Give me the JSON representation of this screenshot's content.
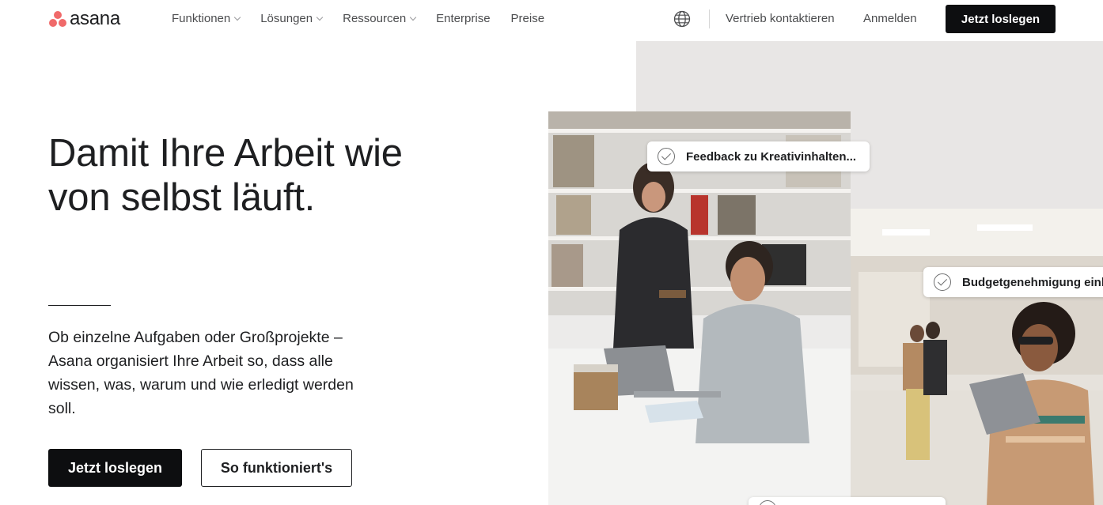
{
  "nav": {
    "logo_text": "asana",
    "menu": [
      {
        "label": "Funktionen",
        "has_dropdown": true
      },
      {
        "label": "Lösungen",
        "has_dropdown": true
      },
      {
        "label": "Ressourcen",
        "has_dropdown": true
      },
      {
        "label": "Enterprise",
        "has_dropdown": false
      },
      {
        "label": "Preise",
        "has_dropdown": false
      }
    ],
    "globe_icon": "globe-icon",
    "contact_sales": "Vertrieb kontaktieren",
    "login": "Anmelden",
    "cta": "Jetzt loslegen"
  },
  "hero": {
    "title_line1": "Damit Ihre Arbeit wie",
    "title_line2": "von selbst läuft.",
    "subtitle": "Ob einzelne Aufgaben oder Großprojekte – Asana organisiert Ihre Arbeit so, dass alle wissen, was, warum und wie erledigt werden soll.",
    "primary_button": "Jetzt loslegen",
    "secondary_button": "So funktioniert's"
  },
  "visual": {
    "task_cards": [
      {
        "label": "Feedback zu Kreativinhalten..."
      },
      {
        "label": "Budgetgenehmigung einholen"
      },
      {
        "label": ""
      }
    ]
  },
  "colors": {
    "brand_coral": "#f06a6a",
    "button_dark": "#0d0e10",
    "text": "#1e1f21",
    "nav_text": "#4b4c4e",
    "panel_bg": "#e8e6e5"
  }
}
